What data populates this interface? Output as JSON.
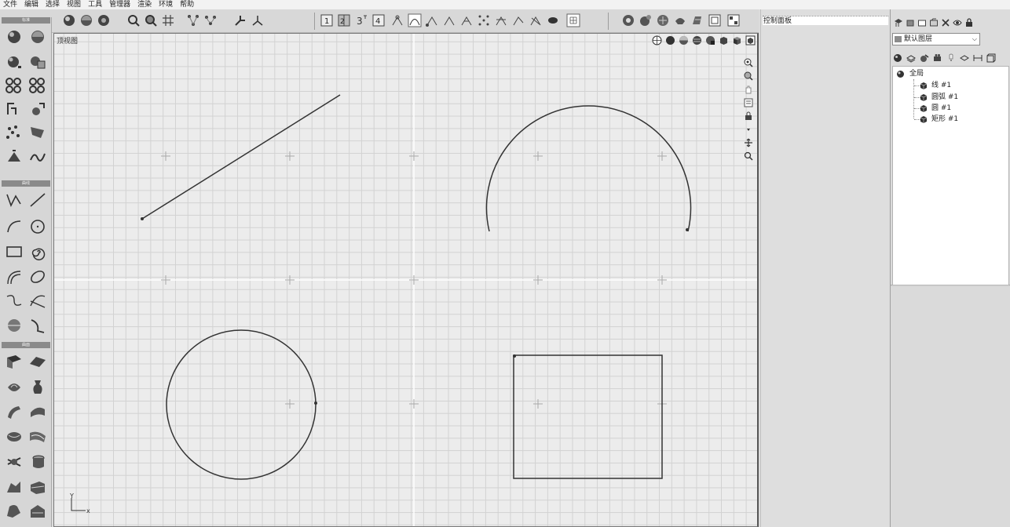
{
  "menu": [
    "文件",
    "编辑",
    "选择",
    "视图",
    "工具",
    "管理器",
    "渲染",
    "环境",
    "帮助"
  ],
  "toolbox": {
    "groups": [
      "标准",
      "曲线",
      "曲面"
    ]
  },
  "viewport": {
    "label": "顶视图",
    "axis": {
      "y": "Y",
      "x": "x"
    }
  },
  "control_panel": {
    "title": "控制面板"
  },
  "layers": {
    "selected_layer": "默认图层",
    "tree": {
      "root": "全局",
      "children": [
        "线 #1",
        "圆弧 #1",
        "圆 #1",
        "矩形 #1"
      ]
    }
  },
  "colors": {
    "background": "#dcdcdc",
    "viewport_bg": "#ececec",
    "grid_minor": "#d2d2d2",
    "grid_axis": "#ffffff",
    "curve": "#333333"
  }
}
